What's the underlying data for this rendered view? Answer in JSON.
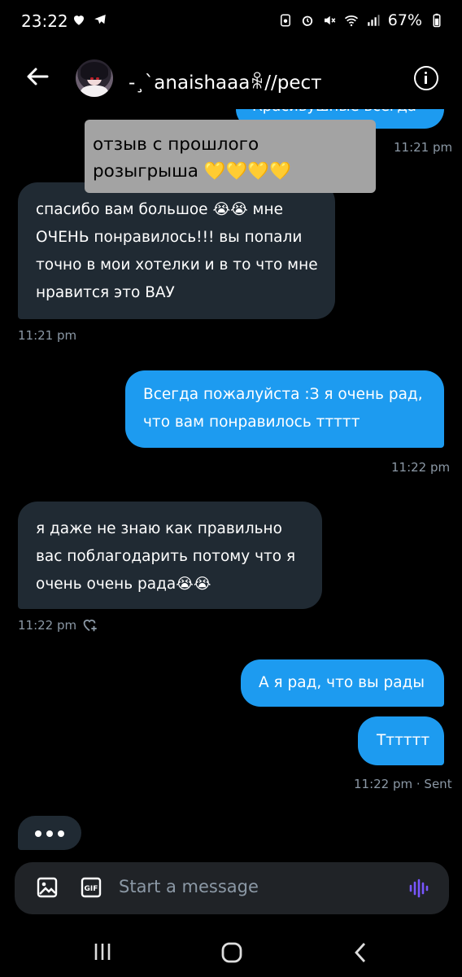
{
  "status": {
    "time": "23:22",
    "battery": "67%"
  },
  "header": {
    "name": "-¸`anaishaaaꆜ//рест"
  },
  "messages": {
    "top_cut_text": "Красивушные всегда",
    "quote_text": "отзыв с прошлого розыгрыша 💛💛💛💛",
    "quote_time": "11:21 pm",
    "m1_text": "спасибо вам большое 😭😭 мне ОЧЕНЬ понравилось!!! вы попали точно в мои хотелки и в то что мне нравится это ВАУ",
    "m1_time": "11:21 pm",
    "m2_text": "Всегда пожалуйста :З я очень рад, что вам понравилось ттттт",
    "m2_time": "11:22 pm",
    "m3_text": "я даже не знаю как правильно вас поблагодарить потому что я очень очень рада😭😭",
    "m3_time": "11:22 pm",
    "m4_text": "А я рад, что вы рады",
    "m5_text": "Тттттт",
    "m5_time": "11:22 pm · Sent"
  },
  "composer": {
    "placeholder": "Start a message"
  },
  "colors": {
    "accent": "#1d9bf0",
    "incoming_bubble": "#202a33",
    "background": "#000000"
  }
}
